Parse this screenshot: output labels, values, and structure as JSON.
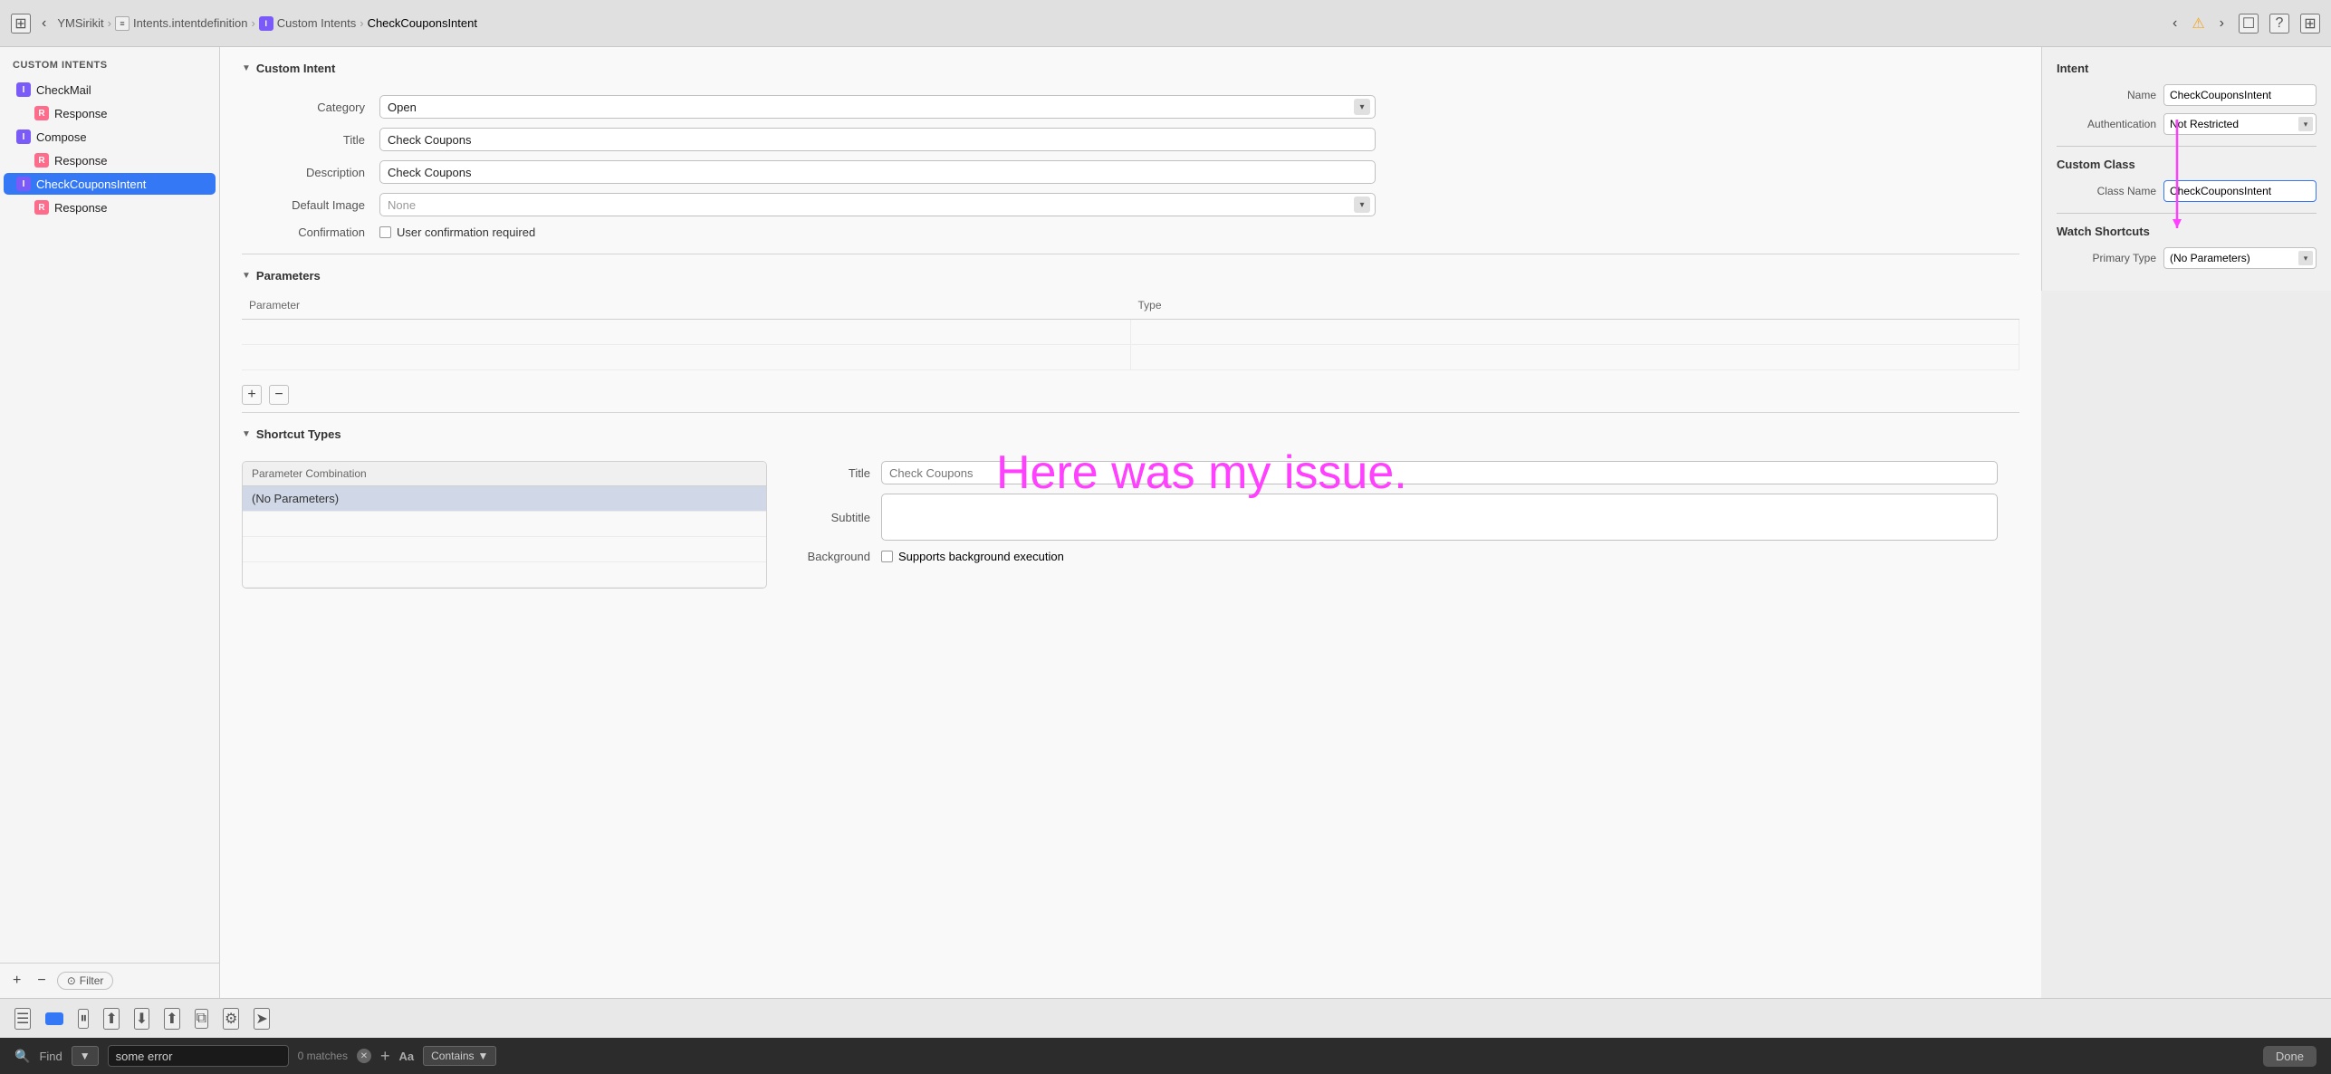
{
  "toolbar": {
    "nav_back": "‹",
    "nav_forward": "›",
    "project": "YMSirikit",
    "breadcrumb_sep1": "›",
    "file": "Intents.intentdefinition",
    "breadcrumb_sep2": "›",
    "section": "Custom Intents",
    "breadcrumb_sep3": "›",
    "current": "CheckCouponsIntent",
    "warning_icon": "⚠",
    "icons_right": [
      "☐",
      "?",
      "⊞"
    ]
  },
  "sidebar": {
    "header": "CUSTOM INTENTS",
    "items": [
      {
        "icon": "I",
        "label": "CheckMail",
        "type": "intent"
      },
      {
        "icon": "R",
        "label": "Response",
        "type": "response"
      },
      {
        "icon": "I",
        "label": "Compose",
        "type": "intent"
      },
      {
        "icon": "R",
        "label": "Response",
        "type": "response"
      },
      {
        "icon": "I",
        "label": "CheckCouponsIntent",
        "type": "intent",
        "selected": true
      },
      {
        "icon": "R",
        "label": "Response",
        "type": "response"
      }
    ],
    "add_label": "+",
    "remove_label": "−",
    "filter_label": "Filter"
  },
  "custom_intent": {
    "section_title": "Custom Intent",
    "category_label": "Category",
    "category_value": "Open",
    "title_label": "Title",
    "title_value": "Check Coupons",
    "description_label": "Description",
    "description_value": "Check Coupons",
    "default_image_label": "Default Image",
    "default_image_value": "None",
    "confirmation_label": "Confirmation",
    "confirmation_check_label": "User confirmation required"
  },
  "parameters": {
    "section_title": "Parameters",
    "col_parameter": "Parameter",
    "col_type": "Type",
    "rows": [
      {
        "parameter": "",
        "type": ""
      },
      {
        "parameter": "",
        "type": ""
      }
    ],
    "add_btn": "+",
    "remove_btn": "−"
  },
  "shortcut_types": {
    "section_title": "Shortcut Types",
    "list_header": "Parameter Combination",
    "items": [
      {
        "label": "(No Parameters)",
        "selected": true
      },
      {
        "label": ""
      },
      {
        "label": ""
      }
    ],
    "title_label": "Title",
    "title_placeholder": "Check Coupons",
    "subtitle_label": "Subtitle",
    "subtitle_value": "",
    "background_label": "Background",
    "background_check_label": "Supports background execution"
  },
  "right_panel": {
    "intent_title": "Intent",
    "name_label": "Name",
    "name_value": "CheckCouponsIntent",
    "authentication_label": "Authentication",
    "authentication_value": "Not Restricted",
    "custom_class_title": "Custom Class",
    "class_name_label": "Class Name",
    "class_name_value": "CheckCouponsIntent",
    "watch_shortcuts_title": "Watch Shortcuts",
    "primary_type_label": "Primary Type",
    "primary_type_value": "(No Parameters)"
  },
  "annotation": {
    "text": "Here was my issue."
  },
  "bottom_toolbar": {
    "icons": [
      "☰",
      "●",
      "⏸",
      "⬆",
      "⬇",
      "⬆",
      "⧉",
      "⚙",
      "➤"
    ]
  },
  "find_bar": {
    "icon": "🔍",
    "label": "Find",
    "dropdown_arrow": "▼",
    "input_value": "some error",
    "matches": "0 matches",
    "add_btn": "+",
    "aa_label": "Aa",
    "contains_label": "Contains",
    "contains_arrow": "▼",
    "done_label": "Done"
  }
}
